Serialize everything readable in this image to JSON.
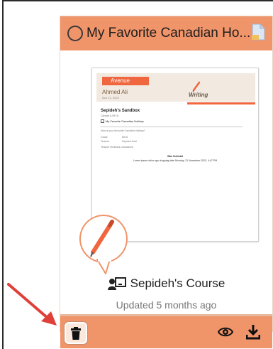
{
  "card": {
    "title": "My Favorite Canadian Ho...",
    "course_name": "Sepideh's Course",
    "updated_text": "Updated 5 months ago"
  },
  "thumbnail": {
    "ribbon": "Avenue",
    "student": "Ahmed Ali",
    "date": "Nov 21, 2022",
    "heading": "Writing",
    "sandbox_title": "Sepideh's Sandbox",
    "sandbox_sub": "Canada (LHE 4)",
    "assignment": "My Favorite Canadian Holiday",
    "prompt": "How is your favourite Canadian holiday?",
    "grade_label": "Grade",
    "grade_value": "6th-8",
    "teacher_label": "Teacher",
    "teacher_value": "Sepideh Azizi",
    "feedback_label": "Teacher feedback: Autosaved",
    "footer_title": "Was Sutimbd",
    "footer_line": "Lorem ipsum dolor ago dropping date Monday, 21 November 2022, 4:47 PM"
  },
  "footer": {
    "delete_icon": "trash-icon",
    "preview_icon": "eye-icon",
    "download_icon": "download-icon"
  },
  "colors": {
    "accent": "#f0946a",
    "ribbon": "#f0663f",
    "annotation_arrow": "#e0403a"
  }
}
